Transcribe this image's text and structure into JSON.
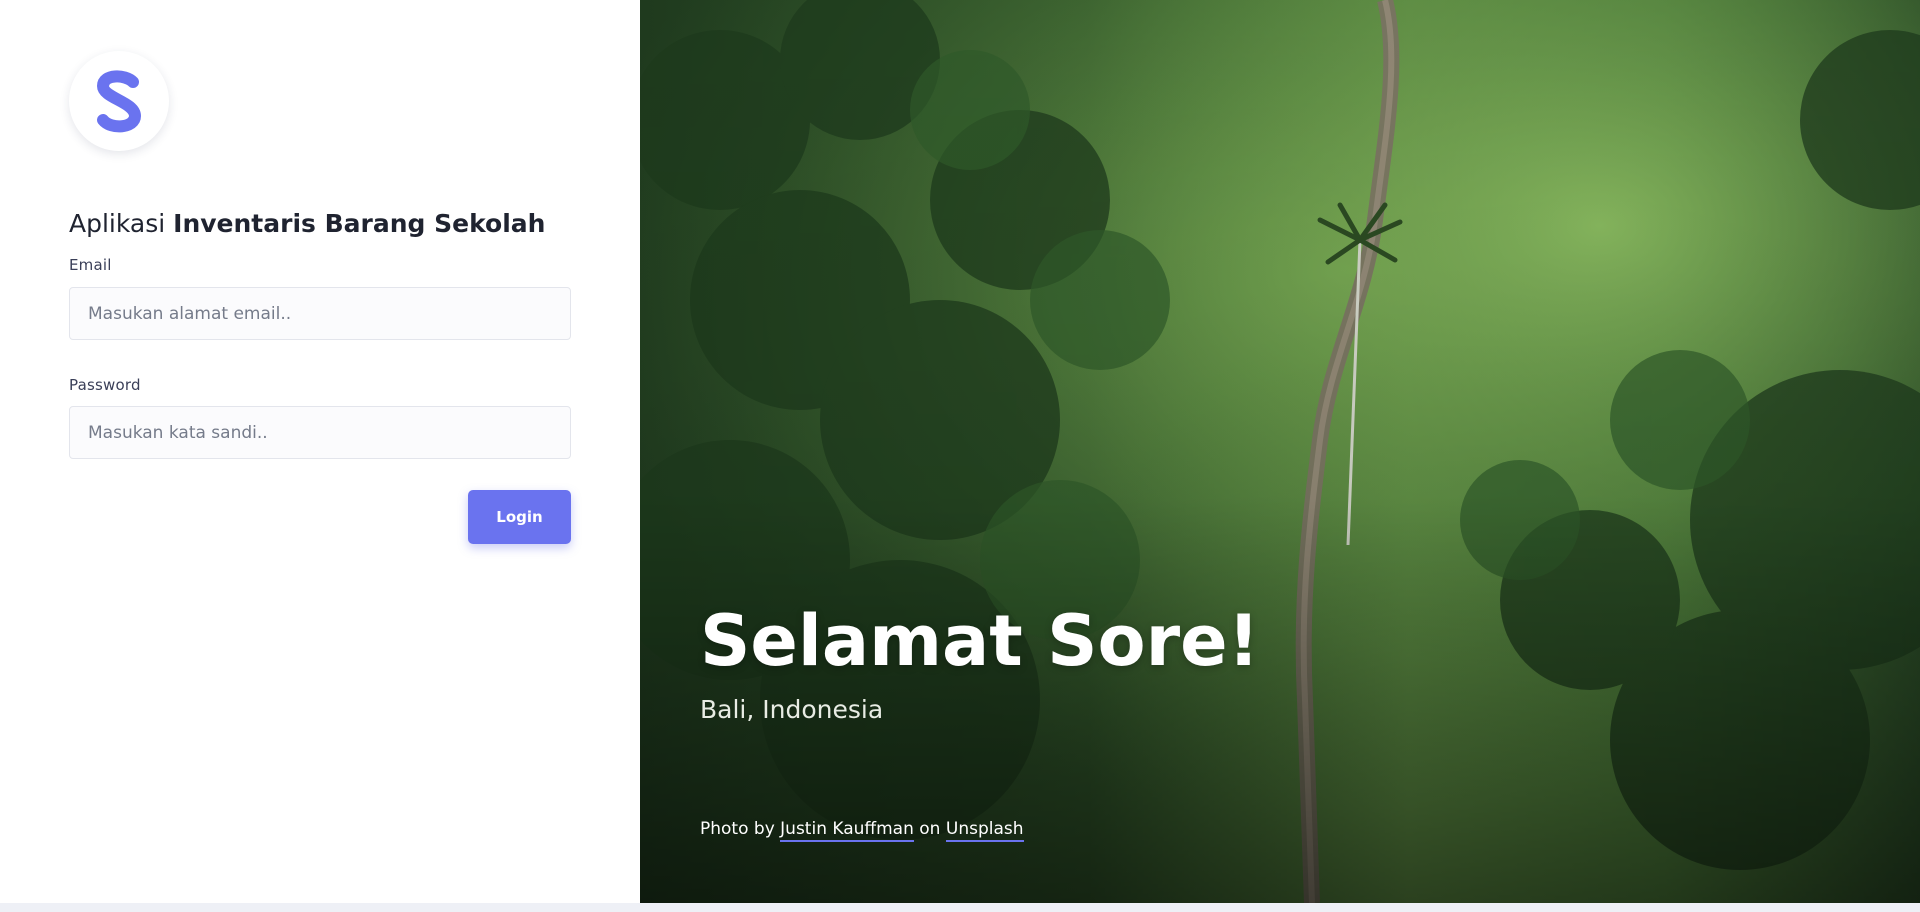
{
  "app": {
    "title_prefix": "Aplikasi",
    "title_strong": "Inventaris Barang Sekolah"
  },
  "form": {
    "email_label": "Email",
    "email_placeholder": "Masukan alamat email..",
    "email_value": "",
    "password_label": "Password",
    "password_placeholder": "Masukan kata sandi..",
    "password_value": "",
    "login_label": "Login"
  },
  "hero": {
    "greeting": "Selamat Sore!",
    "location": "Bali, Indonesia",
    "credit_prefix": "Photo by",
    "credit_author": "Justin Kauffman",
    "credit_middle": "on",
    "credit_source": "Unsplash"
  },
  "icons": {
    "logo": "s-logo-icon"
  },
  "colors": {
    "accent": "#6a73ef",
    "panel": "#ffffff",
    "page_bg": "#eef0f6"
  }
}
